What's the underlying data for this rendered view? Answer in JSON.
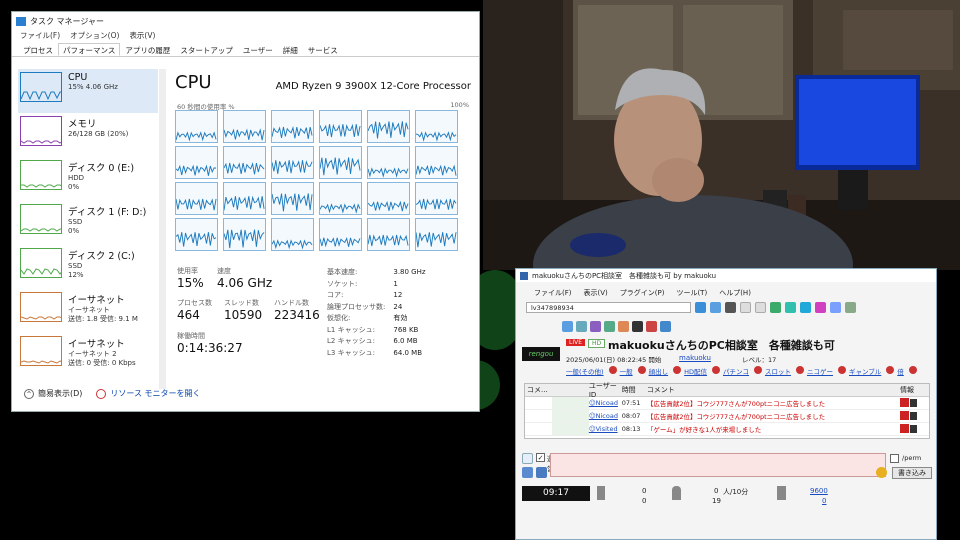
{
  "taskmgr": {
    "title": "タスク マネージャー",
    "menu": [
      "ファイル(F)",
      "オプション(O)",
      "表示(V)"
    ],
    "tabs": [
      "プロセス",
      "パフォーマンス",
      "アプリの履歴",
      "スタートアップ",
      "ユーザー",
      "詳細",
      "サービス"
    ],
    "active_tab": "パフォーマンス",
    "sidebar": [
      {
        "name": "CPU",
        "sub1": "15% 4.06 GHz",
        "sub2": "",
        "color": "#1e7bbf"
      },
      {
        "name": "メモリ",
        "sub1": "26/128 GB (20%)",
        "sub2": "",
        "color": "#8b3fb0"
      },
      {
        "name": "ディスク 0 (E:)",
        "sub1": "HDD",
        "sub2": "0%",
        "color": "#4fa84a"
      },
      {
        "name": "ディスク 1 (F: D:)",
        "sub1": "SSD",
        "sub2": "0%",
        "color": "#4fa84a"
      },
      {
        "name": "ディスク 2 (C:)",
        "sub1": "SSD",
        "sub2": "12%",
        "color": "#4fa84a"
      },
      {
        "name": "イーサネット",
        "sub1": "イーサネット",
        "sub2": "送信: 1.8 受信: 9.1 M",
        "color": "#c8783a"
      },
      {
        "name": "イーサネット",
        "sub1": "イーサネット 2",
        "sub2": "送信: 0 受信: 0 Kbps",
        "color": "#c8783a"
      }
    ],
    "cpu_title": "CPU",
    "cpu_model": "AMD Ryzen 9 3900X 12-Core Processor",
    "graph_caption_left": "60 秒間の使用率 %",
    "graph_caption_right": "100%",
    "stats": [
      {
        "label": "使用率",
        "value": "15%"
      },
      {
        "label": "速度",
        "value": "4.06 GHz"
      },
      {
        "label": "プロセス数",
        "value": "464"
      },
      {
        "label": "スレッド数",
        "value": "10590"
      },
      {
        "label": "ハンドル数",
        "value": "223416"
      },
      {
        "label": "稼働時間",
        "value": "0:14:36:27"
      }
    ],
    "specs": [
      [
        "基本速度:",
        "3.80 GHz"
      ],
      [
        "ソケット:",
        "1"
      ],
      [
        "コア:",
        "12"
      ],
      [
        "論理プロセッサ数:",
        "24"
      ],
      [
        "仮想化:",
        "有効"
      ],
      [
        "L1 キャッシュ:",
        "768 KB"
      ],
      [
        "L2 キャッシュ:",
        "6.0 MB"
      ],
      [
        "L3 キャッシュ:",
        "64.0 MB"
      ]
    ],
    "footer_less": "簡易表示(D)",
    "footer_monitor": "リソース モニターを開く"
  },
  "nicolive": {
    "title": "makuokuさんちのPC相談室　各種雑談も可 by makuoku",
    "menu": [
      "ファイル(F)",
      "表示(V)",
      "プラグイン(P)",
      "ツール(T)",
      "ヘルプ(H)"
    ],
    "lv": "lv347898934",
    "badge_live": "LIVE",
    "badge_hd": "HD",
    "logo": "rengou",
    "stream_title": "makuokuさんちのPC相談室　各種雑談も可",
    "start": "2025/06/01(日) 08:22:45 開始",
    "owner": "makuoku",
    "level": "レベル：17",
    "tags": [
      "一般(その他)",
      "一般",
      "顔出し",
      "HD配信",
      "パチンコ",
      "スロット",
      "ニコゲー",
      "ギャンブル",
      "倍"
    ],
    "columns": [
      "コメ...",
      "ユーザーID",
      "時間",
      "コメント",
      "情報"
    ],
    "rows": [
      {
        "user": "☺Nicoad",
        "time": "07:51",
        "comment": "【広告貢献2位】コウジ777さんが700ptニコニ広告しました"
      },
      {
        "user": "☺Nicoad",
        "time": "08:07",
        "comment": "【広告貢献2位】コウジ777さんが700ptニコニ広告しました"
      },
      {
        "user": "☺Visited",
        "time": "08:13",
        "comment": "「ゲーム」が好きな1人が来場しました"
      }
    ],
    "unei": "運営",
    "perm": "/perm",
    "submit": "書き込み",
    "clock": "09:17",
    "counts": {
      "a": "0",
      "b": "0",
      "c": "0",
      "d": "19",
      "rate": "人/10分",
      "e": "9600",
      "f": "0"
    }
  }
}
